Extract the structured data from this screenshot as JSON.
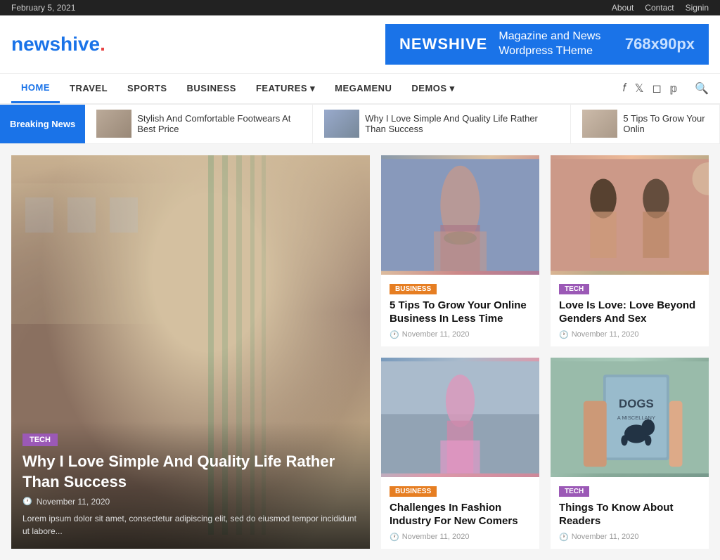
{
  "topbar": {
    "date": "February 5, 2021",
    "links": [
      "About",
      "Contact",
      "Signin"
    ]
  },
  "header": {
    "logo_main": "newshive.",
    "logo_blue": "news",
    "logo_black": "hive.",
    "logo_dot": ".",
    "banner": {
      "name": "NEWSHIVE",
      "text": "Magazine and News\nWordpress THeme",
      "size": "768x90px"
    }
  },
  "nav": {
    "items": [
      {
        "label": "HOME",
        "active": true
      },
      {
        "label": "TRAVEL",
        "active": false
      },
      {
        "label": "SPORTS",
        "active": false
      },
      {
        "label": "BUSINESS",
        "active": false
      },
      {
        "label": "FEATURES",
        "active": false,
        "dropdown": true
      },
      {
        "label": "MEGAMENU",
        "active": false
      },
      {
        "label": "DEMOS",
        "active": false,
        "dropdown": true
      }
    ],
    "socials": [
      "facebook",
      "twitter",
      "instagram",
      "pinterest"
    ],
    "search_label": "Search"
  },
  "breaking_news": {
    "label": "Breaking News",
    "items": [
      {
        "text": "Stylish And Comfortable Footwears At Best Price"
      },
      {
        "text": "Why I Love Simple And Quality Life Rather Than Success"
      },
      {
        "text": "5 Tips To Grow Your Onlin"
      }
    ]
  },
  "hero": {
    "category": "TECH",
    "title": "Why I Love Simple And Quality Life Rather Than Success",
    "date": "November 11, 2020",
    "excerpt": "Lorem ipsum dolor sit amet, consectetur adipiscing elit, sed do eiusmod tempor incididunt ut labore..."
  },
  "cards": [
    {
      "id": "card1",
      "category": "BUSINESS",
      "cat_class": "cat-business",
      "img_class": "fashion1",
      "title": "5 Tips To Grow Your Online Business In Less Time",
      "date": "November 11, 2020"
    },
    {
      "id": "card2",
      "category": "TECH",
      "cat_class": "cat-tech",
      "img_class": "ladies",
      "title": "Love Is Love: Love Beyond Genders And Sex",
      "date": "November 11, 2020"
    },
    {
      "id": "card3",
      "category": "BUSINESS",
      "cat_class": "cat-business",
      "img_class": "fashion2",
      "title": "Challenges In Fashion Industry For New Comers",
      "date": "November 11, 2020"
    },
    {
      "id": "card4",
      "category": "TECH",
      "cat_class": "cat-tech",
      "img_class": "book",
      "title": "Things To Know About Readers",
      "date": "November 11, 2020"
    }
  ]
}
